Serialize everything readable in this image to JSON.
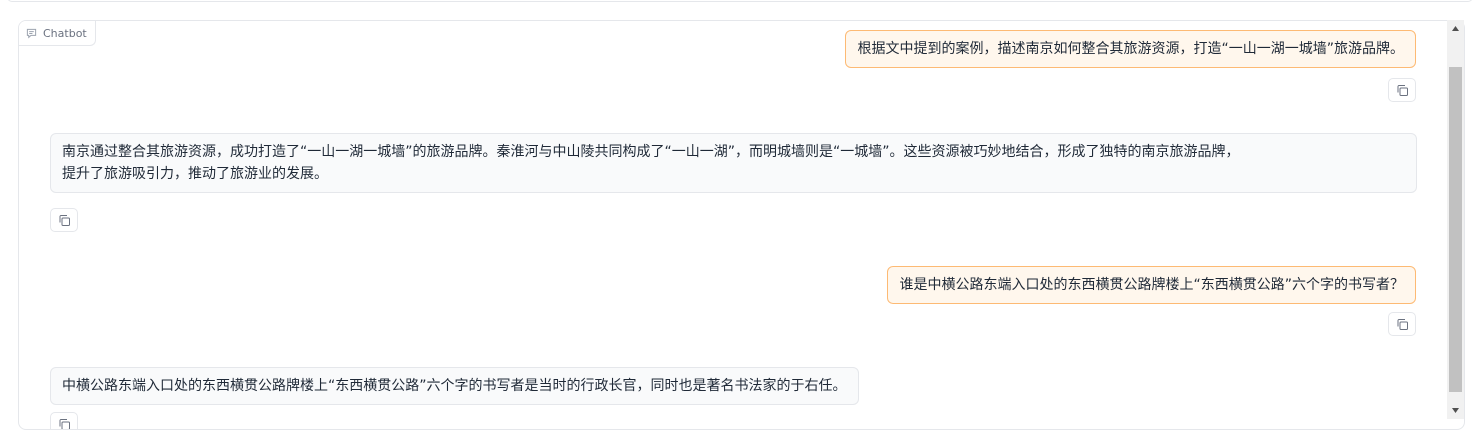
{
  "chatbot": {
    "label": "Chatbot",
    "label_icon": "chat-bubble-icon"
  },
  "messages": [
    {
      "role": "user",
      "text": "根据文中提到的案例，描述南京如何整合其旅游资源，打造“一山一湖一城墙”旅游品牌。"
    },
    {
      "role": "bot",
      "lines": [
        "南京通过整合其旅游资源，成功打造了“一山一湖一城墙”的旅游品牌。秦淮河与中山陵共同构成了“一山一湖”，而明城墙则是“一城墙”。这些资源被巧妙地结合，形成了独特的南京旅游品牌，",
        "提升了旅游吸引力，推动了旅游业的发展。"
      ]
    },
    {
      "role": "user",
      "text": "谁是中横公路东端入口处的东西横贯公路牌楼上“东西横贯公路”六个字的书写者？"
    },
    {
      "role": "bot",
      "text": "中横公路东端入口处的东西横贯公路牌楼上“东西横贯公路”六个字的书写者是当时的行政长官，同时也是著名书法家的于右任。"
    }
  ],
  "icons": {
    "copy": "copy-icon",
    "scroll_up": "arrow-up-icon",
    "scroll_down": "arrow-down-icon"
  }
}
